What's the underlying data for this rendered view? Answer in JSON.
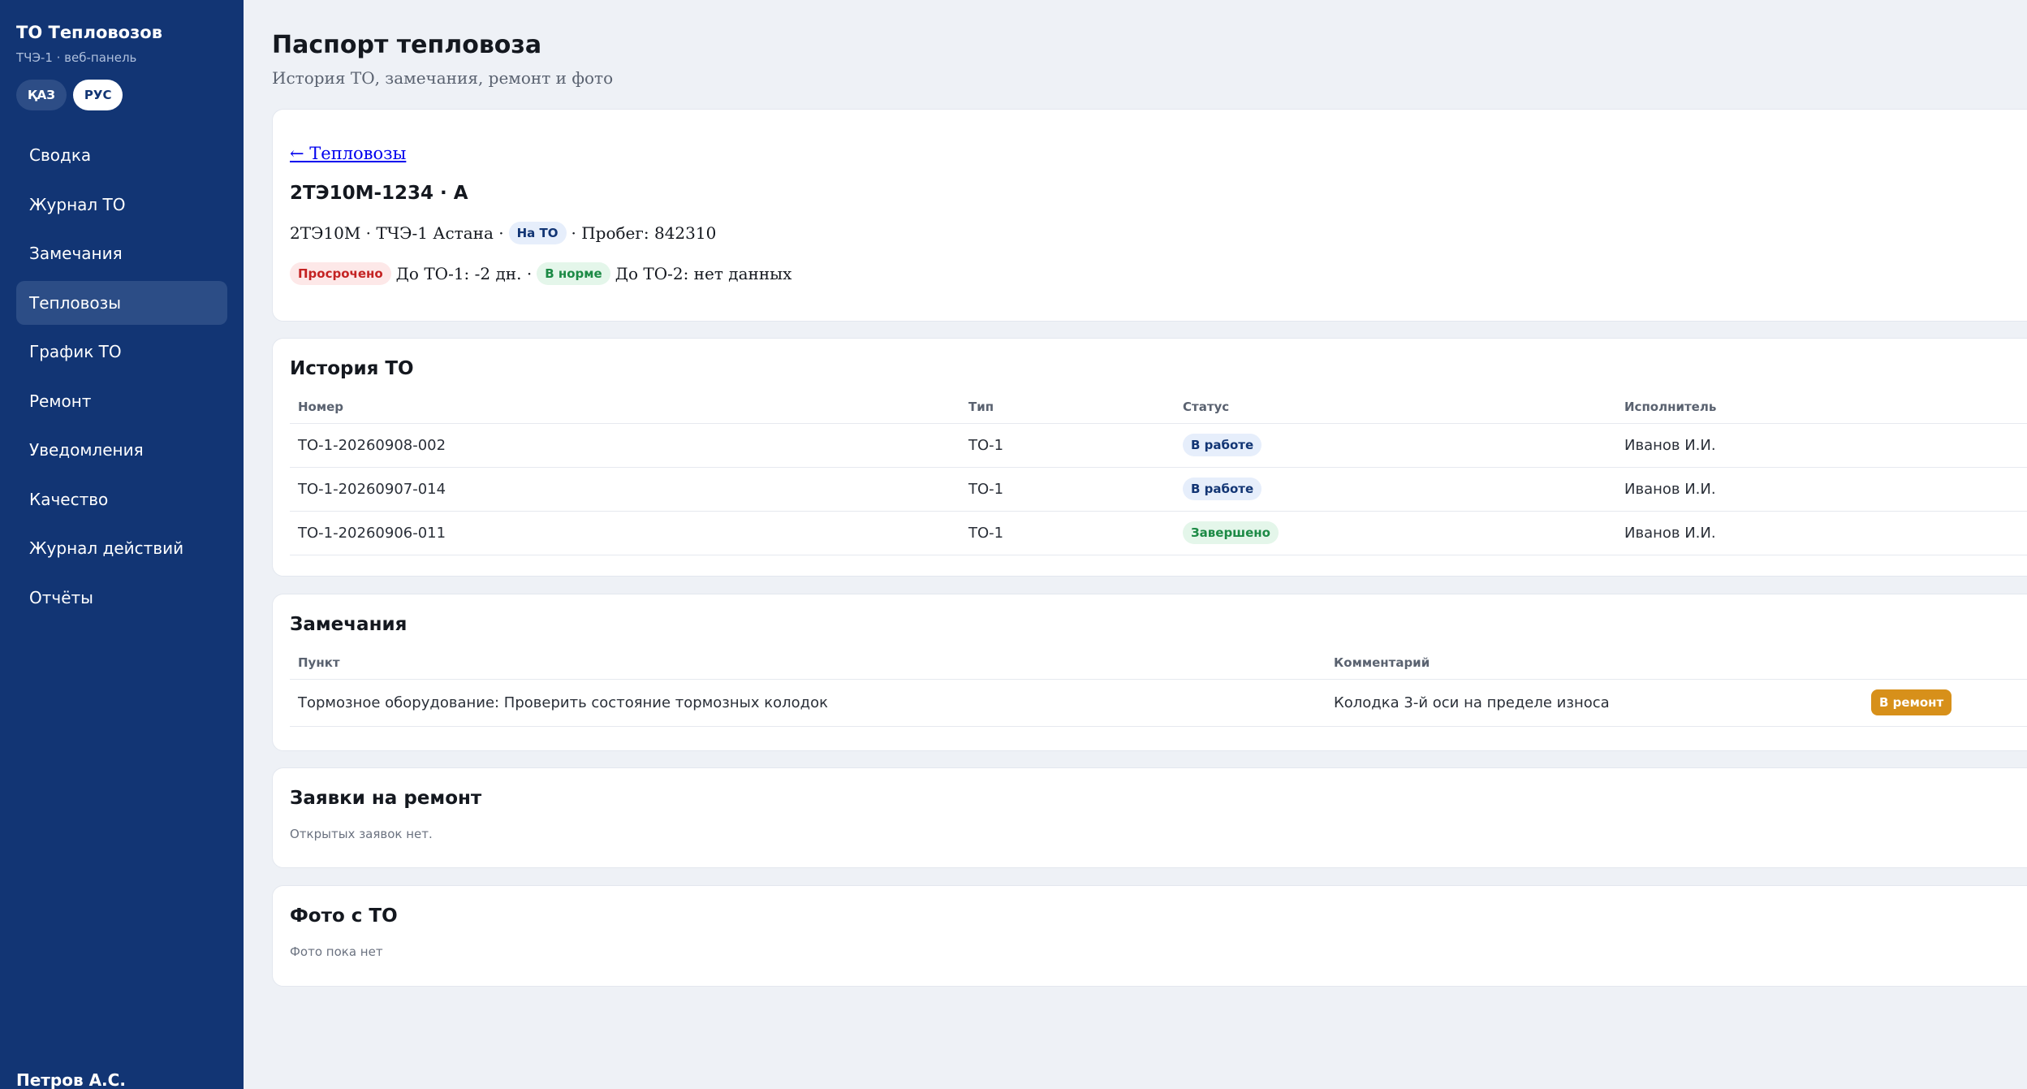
{
  "sidebar": {
    "brand": "ТО Тепловозов",
    "subtitle": "ТЧЭ-1 · веб-панель",
    "languages": [
      {
        "label": "ҚАЗ",
        "active": false
      },
      {
        "label": "РУС",
        "active": true
      }
    ],
    "items": [
      {
        "label": "Сводка",
        "active": false
      },
      {
        "label": "Журнал ТО",
        "active": false
      },
      {
        "label": "Замечания",
        "active": false
      },
      {
        "label": "Тепловозы",
        "active": true
      },
      {
        "label": "График ТО",
        "active": false
      },
      {
        "label": "Ремонт",
        "active": false
      },
      {
        "label": "Уведомления",
        "active": false
      },
      {
        "label": "Качество",
        "active": false
      },
      {
        "label": "Журнал действий",
        "active": false
      },
      {
        "label": "Отчёты",
        "active": false
      }
    ],
    "user": "Петров А.С."
  },
  "page": {
    "title": "Паспорт тепловоза",
    "subtitle": "История ТО, замечания, ремонт и фото"
  },
  "loco": {
    "back_link": "← Тепловозы",
    "title": "2ТЭ10М-1234 · А",
    "model_depot": "2ТЭ10М · ТЧЭ-1 Астана ·",
    "status_badge": "На ТО",
    "mileage": "· Пробег: 842310",
    "to1_badge": "Просрочено",
    "to1_text": "До ТО-1: -2 дн. ·",
    "to2_badge": "В норме",
    "to2_text": "До ТО-2: нет данных"
  },
  "history": {
    "title": "История ТО",
    "columns": [
      "Номер",
      "Тип",
      "Статус",
      "Исполнитель"
    ],
    "rows": [
      {
        "number": "ТО-1-20260908-002",
        "type": "ТО-1",
        "status": "В работе",
        "status_kind": "blue",
        "executor": "Иванов И.И."
      },
      {
        "number": "ТО-1-20260907-014",
        "type": "ТО-1",
        "status": "В работе",
        "status_kind": "blue",
        "executor": "Иванов И.И."
      },
      {
        "number": "ТО-1-20260906-011",
        "type": "ТО-1",
        "status": "Завершено",
        "status_kind": "green",
        "executor": "Иванов И.И."
      }
    ]
  },
  "remarks": {
    "title": "Замечания",
    "columns": [
      "Пункт",
      "Комментарий"
    ],
    "rows": [
      {
        "item": "Тормозное оборудование: Проверить состояние тормозных колодок",
        "comment": "Колодка 3-й оси на пределе износа",
        "action": "В ремонт"
      }
    ]
  },
  "repair": {
    "title": "Заявки на ремонт",
    "empty": "Открытых заявок нет."
  },
  "photos": {
    "title": "Фото с ТО",
    "empty": "Фото пока нет"
  }
}
